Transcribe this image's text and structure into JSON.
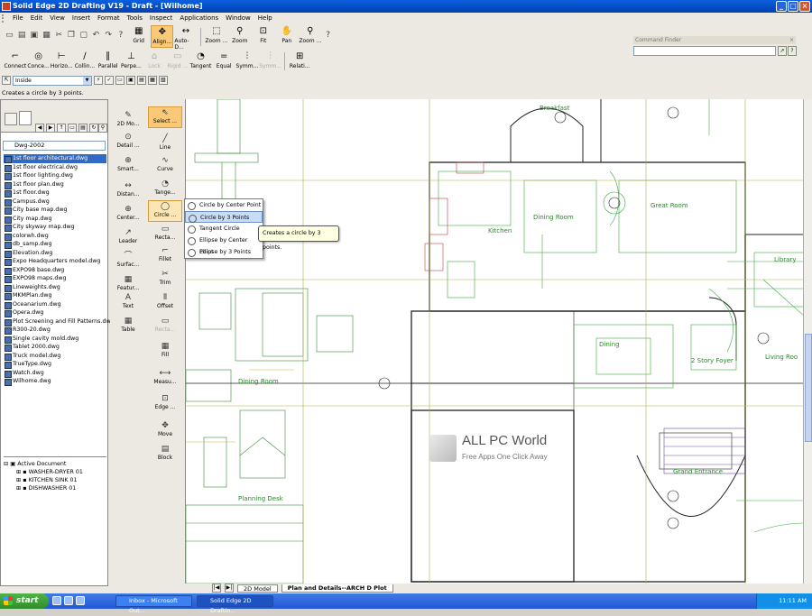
{
  "window": {
    "title": "Solid Edge 2D Drafting V19 - Draft - [Wilhome]"
  },
  "menu": [
    "File",
    "Edit",
    "View",
    "Insert",
    "Format",
    "Tools",
    "Inspect",
    "Applications",
    "Window",
    "Help"
  ],
  "toolbar_top": {
    "buttons": [
      "Grid",
      "Align...",
      "Auto-D...",
      "Zoom ...",
      "Zoom",
      "Fit",
      "Pan",
      "Zoom ..."
    ]
  },
  "toolbar_relations": [
    "Connect",
    "Conce...",
    "Horizo...",
    "Collin...",
    "Parallel",
    "Perpe...",
    "Lock",
    "Rigid ...",
    "Tangent",
    "Equal",
    "Symm...",
    "Symm...",
    "Relati..."
  ],
  "select_mode": {
    "value": "Inside"
  },
  "status": {
    "prompt": "Creates a circle by 3 points."
  },
  "command_finder": {
    "title": "Command Finder",
    "close": "×"
  },
  "library": {
    "folder": "Dwg-2002",
    "files": [
      "1st floor architectural.dwg",
      "1st floor electrical.dwg",
      "1st floor lighting.dwg",
      "1st floor plan.dwg",
      "1st floor.dwg",
      "Campus.dwg",
      "City base map.dwg",
      "City map.dwg",
      "City skyway map.dwg",
      "colorwh.dwg",
      "db_samp.dwg",
      "Elevation.dwg",
      "Expo Headquarters model.dwg",
      "EXPO98 base.dwg",
      "EXPO98 maps.dwg",
      "Lineweights.dwg",
      "MKMPlan.dwg",
      "Oceanarium.dwg",
      "Opera.dwg",
      "Plot Screening and Fill Patterns.dwg",
      "R300-20.dwg",
      "Single cavity mold.dwg",
      "Tablet 2000.dwg",
      "Truck model.dwg",
      "TrueType.dwg",
      "Watch.dwg",
      "Wilhome.dwg"
    ],
    "selected_index": 0
  },
  "tree": {
    "root": "Active Document",
    "items": [
      "WASHER-DRYER 01",
      "KITCHEN SINK 01",
      "DISHWASHER 01"
    ]
  },
  "ribbon_col1": [
    "2D Mo...",
    "Detail ...",
    "Smart...",
    "Distan...",
    "Center...",
    "Leader",
    "Surfac...",
    "Featur...",
    "Text",
    "Table"
  ],
  "ribbon_col2": [
    "Select ...",
    "Line",
    "Curve",
    "Tange...",
    "Circle ...",
    "Recta...",
    "Fillet",
    "Trim",
    "Offset",
    "Recta...",
    "Fill",
    "Measu...",
    "Edge ...",
    "Move",
    "Block"
  ],
  "circle_menu": {
    "items": [
      "Circle by Center Point",
      "Circle by 3 Points",
      "Tangent Circle",
      "Ellipse by Center Point",
      "Ellipse by 3 Points"
    ],
    "selected_index": 1
  },
  "tooltip": "Creates a circle by 3 points.",
  "drawing_labels": [
    "Breakfast",
    "Dining Room",
    "Great Room",
    "Kitchen",
    "Dining",
    "2 Story Foyer",
    "Living Roo",
    "Grand Entrance",
    "Library",
    "Dining Room",
    "Planning Desk"
  ],
  "sheet_tabs": [
    "2D Model",
    "Plan and Details--ARCH D Plot"
  ],
  "watermark": {
    "title": "ALL PC World",
    "subtitle": "Free Apps One Click Away"
  },
  "taskbar": {
    "start": "start",
    "tasks": [
      "Inbox - Microsoft Out...",
      "Solid Edge 2D Draftin..."
    ],
    "clock": "11:11 AM"
  }
}
